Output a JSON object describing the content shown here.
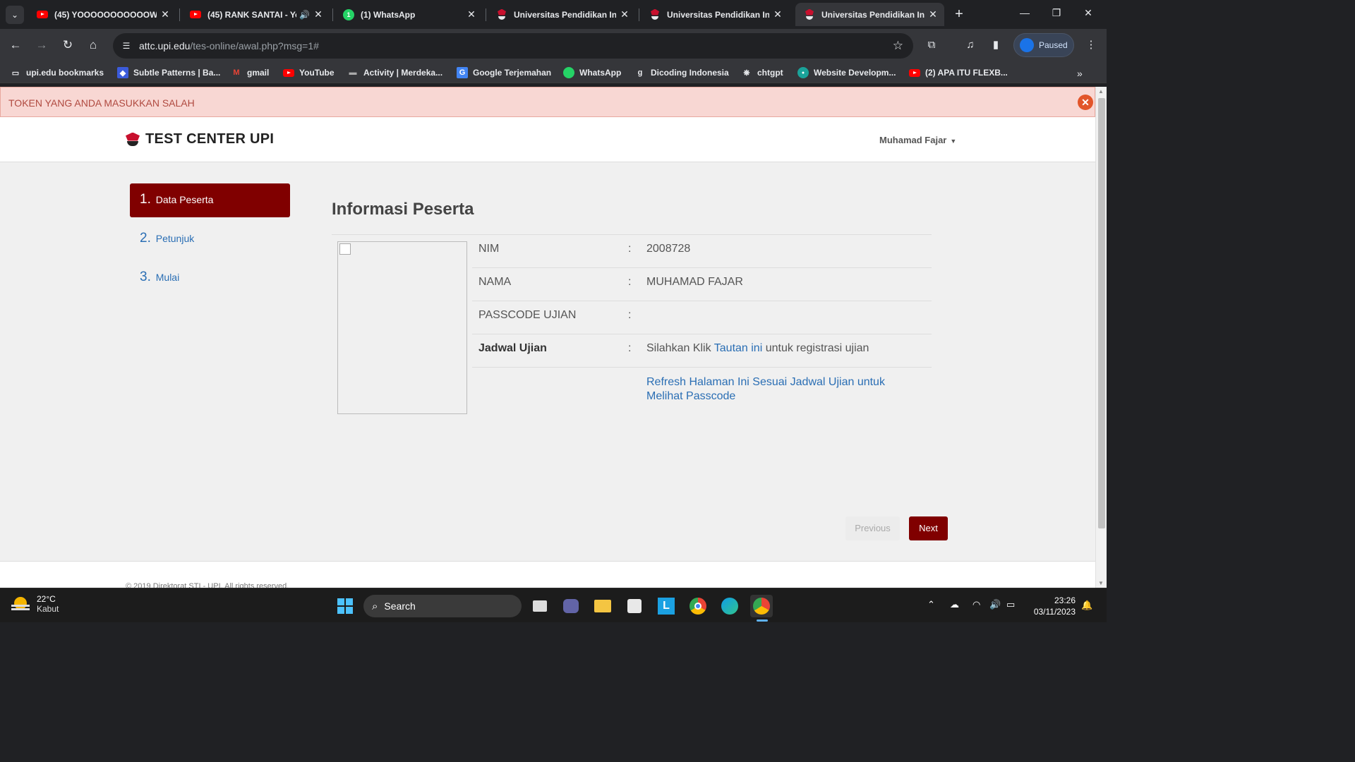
{
  "browser": {
    "tabs": [
      {
        "title": "(45) YOOOOOOOOOOOW",
        "icon": "youtube-icon"
      },
      {
        "title": "(45) RANK SANTAI - Yo",
        "icon": "youtube-icon",
        "audio": "speaker-icon"
      },
      {
        "title": "(1) WhatsApp",
        "icon": "whatsapp-icon"
      },
      {
        "title": "Universitas Pendidikan Ind",
        "icon": "upi-icon"
      },
      {
        "title": "Universitas Pendidikan Ind",
        "icon": "upi-icon"
      },
      {
        "title": "Universitas Pendidikan Ind",
        "icon": "upi-icon",
        "active": true
      }
    ],
    "url_host": "attc.upi.edu",
    "url_path": "/tes-online/awal.php?msg=1#",
    "profile_label": "Paused",
    "bookmarks": [
      {
        "label": "upi.edu bookmarks",
        "icon": "folder-icon"
      },
      {
        "label": "Subtle Patterns | Ba...",
        "icon": "subtle-patterns-icon"
      },
      {
        "label": "gmail",
        "icon": "gmail-icon"
      },
      {
        "label": "YouTube",
        "icon": "youtube-icon"
      },
      {
        "label": "Activity | Merdeka...",
        "icon": "merdeka-icon"
      },
      {
        "label": "Google Terjemahan",
        "icon": "google-translate-icon"
      },
      {
        "label": "WhatsApp",
        "icon": "whatsapp-icon"
      },
      {
        "label": "Dicoding Indonesia",
        "icon": "dicoding-icon"
      },
      {
        "label": "chtgpt",
        "icon": "chatgpt-icon"
      },
      {
        "label": "Website Developm...",
        "icon": "website-icon"
      },
      {
        "label": "(2) APA ITU FLEXB...",
        "icon": "youtube-icon"
      }
    ]
  },
  "page": {
    "alert": "TOKEN YANG ANDA MASUKKAN SALAH",
    "brand": "TEST CENTER UPI",
    "user": "Muhamad Fajar",
    "steps": [
      {
        "num": "1.",
        "label": "Data Peserta",
        "active": true
      },
      {
        "num": "2.",
        "label": "Petunjuk"
      },
      {
        "num": "3.",
        "label": "Mulai"
      }
    ],
    "title": "Informasi Peserta",
    "info": {
      "nim_label": "NIM",
      "nim_value": "2008728",
      "nama_label": "NAMA",
      "nama_value": "MUHAMAD FAJAR",
      "passcode_label": "PASSCODE UJIAN",
      "passcode_value": "",
      "jadwal_label": "Jadwal Ujian",
      "jadwal_prefix": "Silahkan Klik ",
      "jadwal_link": "Tautan ini",
      "jadwal_suffix": " untuk registrasi ujian",
      "refresh_link": "Refresh Halaman Ini Sesuai Jadwal Ujian untuk Melihat Passcode",
      "colon": ":"
    },
    "prev_label": "Previous",
    "next_label": "Next",
    "footer_text": "© 2019 Direktorat STI - UPI. All rights reserved."
  },
  "taskbar": {
    "temperature": "22°C",
    "weather": "Kabut",
    "search_label": "Search",
    "time": "23:26",
    "date": "03/11/2023"
  },
  "colors": {
    "accent": "#800000",
    "link": "#2a6eb4",
    "alert_bg": "#f8d7d3"
  }
}
